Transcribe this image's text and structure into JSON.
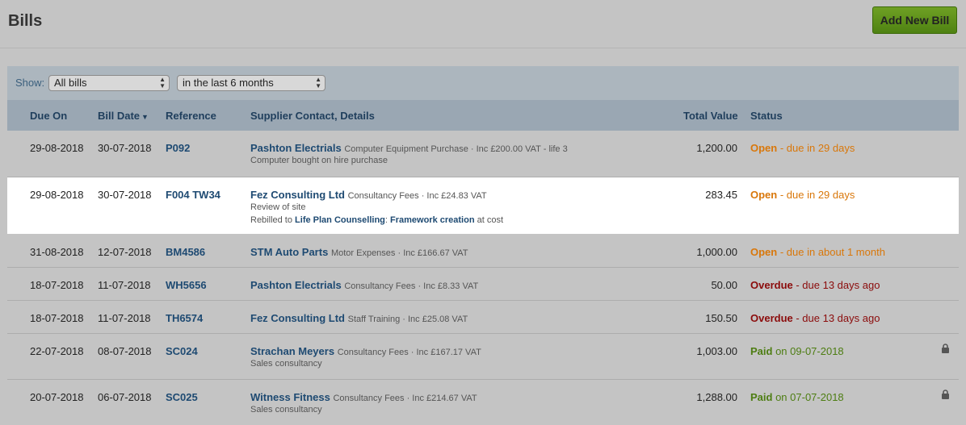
{
  "page": {
    "title": "Bills",
    "add_button": "Add New Bill"
  },
  "filters": {
    "show_label": "Show:",
    "type_value": "All bills",
    "period_value": "in the last 6 months"
  },
  "columns": {
    "due_on": "Due On",
    "bill_date": "Bill Date",
    "reference": "Reference",
    "supplier": "Supplier Contact, Details",
    "total": "Total Value",
    "status": "Status"
  },
  "rows": [
    {
      "due": "29-08-2018",
      "date": "30-07-2018",
      "ref": "P092",
      "supplier": "Pashton Electrials",
      "details": "Computer Equipment Purchase · Inc £200.00 VAT - life 3",
      "sub1": "Computer bought on hire purchase",
      "total": "1,200.00",
      "status_word": "Open",
      "status_rest": " - due in 29 days"
    },
    {
      "due": "29-08-2018",
      "date": "30-07-2018",
      "ref": "F004 TW34",
      "supplier": "Fez Consulting Ltd",
      "details": "Consultancy Fees · Inc £24.83 VAT",
      "sub1": "Review of site",
      "rebill_prefix": "Rebilled to ",
      "rebill_contact": "Life Plan Counselling",
      "rebill_sep": ": ",
      "rebill_project": "Framework creation",
      "rebill_suffix": " at cost",
      "total": "283.45",
      "status_word": "Open",
      "status_rest": " - due in 29 days"
    },
    {
      "due": "31-08-2018",
      "date": "12-07-2018",
      "ref": "BM4586",
      "supplier": "STM Auto Parts",
      "details": "Motor Expenses · Inc £166.67 VAT",
      "total": "1,000.00",
      "status_word": "Open",
      "status_rest": " - due in about 1 month"
    },
    {
      "due": "18-07-2018",
      "date": "11-07-2018",
      "ref": "WH5656",
      "supplier": "Pashton Electrials",
      "details": "Consultancy Fees · Inc £8.33 VAT",
      "total": "50.00",
      "status_word": "Overdue",
      "status_rest": " - due 13 days ago"
    },
    {
      "due": "18-07-2018",
      "date": "11-07-2018",
      "ref": "TH6574",
      "supplier": "Fez Consulting Ltd",
      "details": "Staff Training · Inc £25.08 VAT",
      "total": "150.50",
      "status_word": "Overdue",
      "status_rest": " - due 13 days ago"
    },
    {
      "due": "22-07-2018",
      "date": "08-07-2018",
      "ref": "SC024",
      "supplier": "Strachan Meyers",
      "details": "Consultancy Fees · Inc £167.17 VAT",
      "sub1": "Sales consultancy",
      "total": "1,003.00",
      "status_word": "Paid",
      "status_rest": " on 09-07-2018"
    },
    {
      "due": "20-07-2018",
      "date": "06-07-2018",
      "ref": "SC025",
      "supplier": "Witness Fitness",
      "details": "Consultancy Fees · Inc £214.67 VAT",
      "sub1": "Sales consultancy",
      "total": "1,288.00",
      "status_word": "Paid",
      "status_rest": " on 07-07-2018"
    }
  ],
  "colors": {
    "open": "#d9770a",
    "overdue": "#8b0b0b",
    "paid": "#4d7d12",
    "link": "#1e4a72"
  }
}
